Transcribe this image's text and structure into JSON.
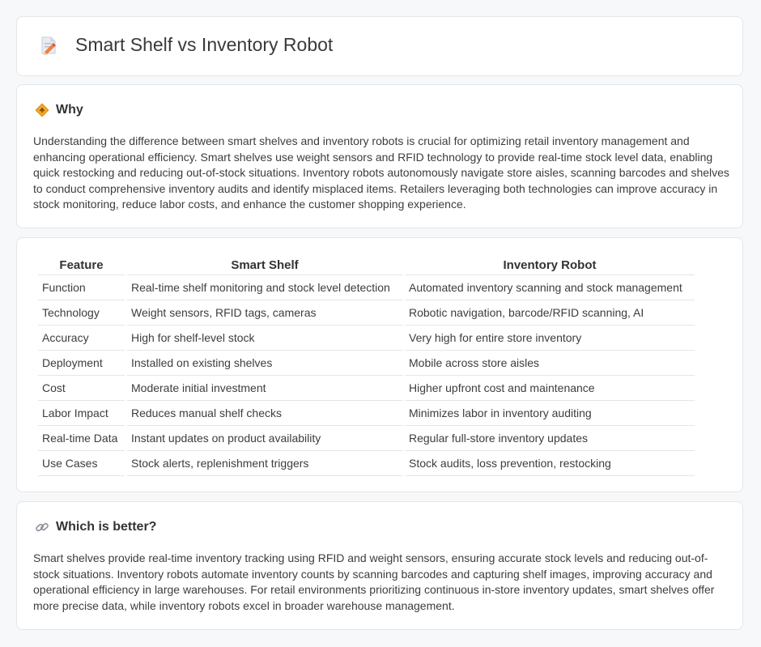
{
  "header": {
    "title": "Smart Shelf vs Inventory Robot",
    "icon": "document-pencil-icon"
  },
  "why": {
    "heading": "Why",
    "icon": "diamond-sign-icon",
    "text": "Understanding the difference between smart shelves and inventory robots is crucial for optimizing retail inventory management and enhancing operational efficiency. Smart shelves use weight sensors and RFID technology to provide real-time stock level data, enabling quick restocking and reducing out-of-stock situations. Inventory robots autonomously navigate store aisles, scanning barcodes and shelves to conduct comprehensive inventory audits and identify misplaced items. Retailers leveraging both technologies can improve accuracy in stock monitoring, reduce labor costs, and enhance the customer shopping experience."
  },
  "comparison": {
    "headers": [
      "Feature",
      "Smart Shelf",
      "Inventory Robot"
    ],
    "rows": [
      [
        "Function",
        "Real-time shelf monitoring and stock level detection",
        "Automated inventory scanning and stock management"
      ],
      [
        "Technology",
        "Weight sensors, RFID tags, cameras",
        "Robotic navigation, barcode/RFID scanning, AI"
      ],
      [
        "Accuracy",
        "High for shelf-level stock",
        "Very high for entire store inventory"
      ],
      [
        "Deployment",
        "Installed on existing shelves",
        "Mobile across store aisles"
      ],
      [
        "Cost",
        "Moderate initial investment",
        "Higher upfront cost and maintenance"
      ],
      [
        "Labor Impact",
        "Reduces manual shelf checks",
        "Minimizes labor in inventory auditing"
      ],
      [
        "Real-time Data",
        "Instant updates on product availability",
        "Regular full-store inventory updates"
      ],
      [
        "Use Cases",
        "Stock alerts, replenishment triggers",
        "Stock audits, loss prevention, restocking"
      ]
    ]
  },
  "better": {
    "heading": "Which is better?",
    "icon": "link-icon",
    "text": "Smart shelves provide real-time inventory tracking using RFID and weight sensors, ensuring accurate stock levels and reducing out-of-stock situations. Inventory robots automate inventory counts by scanning barcodes and capturing shelf images, improving accuracy and operational efficiency in large warehouses. For retail environments prioritizing continuous in-store inventory updates, smart shelves offer more precise data, while inventory robots excel in broader warehouse management."
  }
}
